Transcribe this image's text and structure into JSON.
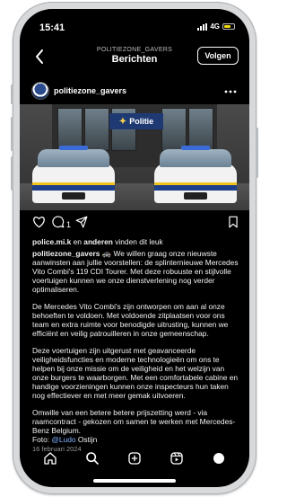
{
  "status": {
    "time": "15:41",
    "network": "4G"
  },
  "header": {
    "account": "POLITIEZONE_GAVERS",
    "title": "Berichten",
    "follow_label": "Volgen"
  },
  "post": {
    "username": "politiezone_gavers",
    "photo_sign_text": "Politie",
    "like_count": "1",
    "likes_user": "police.mi.k",
    "likes_connector": "en",
    "likes_others": "anderen",
    "likes_suffix": "vinden dit leuk",
    "caption_username": "politiezone_gavers",
    "caption_emoji": "🚓",
    "paragraph_1": "We willen graag onze nieuwste aanwinsten aan jullie voorstellen: de splinternieuwe Mercedes Vito Combi's 119 CDI Tourer. Met deze robuuste en stijlvolle voertuigen kunnen we onze dienstverlening nog verder optimaliseren.",
    "paragraph_2": "De Mercedes Vito Combi's zijn ontworpen om aan al onze behoeften te voldoen. Met voldoende zitplaatsen voor ons team en extra ruimte voor benodigde uitrusting, kunnen we efficiënt en veilig patrouilleren in onze gemeenschap.",
    "paragraph_3": "Deze voertuigen zijn uitgerust met geavanceerde veiligheidsfuncties en moderne technologieën om ons te helpen bij onze missie om de veiligheid en het welzijn van onze burgers te waarborgen. Met een comfortabele cabine en handige voorzieningen kunnen onze inspecteurs hun taken nog effectiever en met meer gemak uitvoeren.",
    "paragraph_4": "Omwille van een betere betere prijszetting werd - via raamcontract - gekozen om samen te werken met Mercedes-Benz Belgium.",
    "photo_credit_prefix": "Foto:",
    "photo_credit_link": "@Ludo",
    "photo_credit_suffix": "Ostijn",
    "date": "16 februari 2024"
  },
  "icons": {
    "back": "chevron-left-icon",
    "more": "more-icon",
    "like": "heart-icon",
    "comment": "comment-icon",
    "share": "send-icon",
    "save": "bookmark-icon",
    "nav": [
      "home-icon",
      "search-icon",
      "create-icon",
      "reels-icon",
      "profile-icon"
    ]
  },
  "colors": {
    "background": "#000000",
    "link": "#7fb0ff",
    "battery": "#f5d90a",
    "follow_border": "#ffffff"
  }
}
